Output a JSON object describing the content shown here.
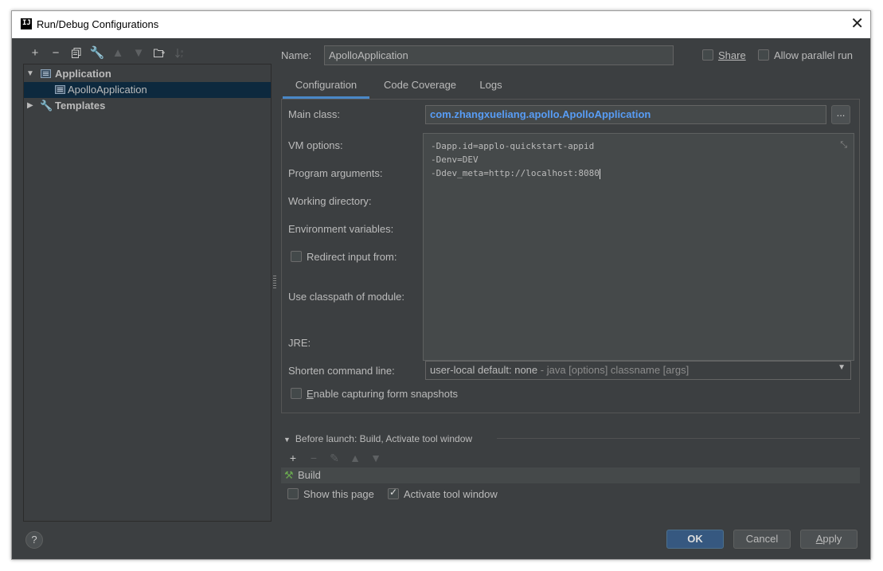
{
  "window": {
    "title": "Run/Debug Configurations",
    "logo_text": "IJ"
  },
  "tree": {
    "items": [
      {
        "label": "Application",
        "expanded": true
      },
      {
        "label": "ApolloApplication",
        "selected": true
      },
      {
        "label": "Templates",
        "expanded": false
      }
    ]
  },
  "left_toolbar": {
    "icons": [
      "add-icon",
      "remove-icon",
      "copy-icon",
      "wrench-icon",
      "move-up-icon",
      "move-down-icon",
      "new-folder-icon",
      "sort-icon"
    ]
  },
  "header": {
    "name_label": "Name:",
    "name_value": "ApolloApplication",
    "share_label": "Share",
    "allow_parallel_label": "Allow parallel run"
  },
  "tabs": [
    {
      "label": "Configuration",
      "active": true
    },
    {
      "label": "Code Coverage",
      "active": false
    },
    {
      "label": "Logs",
      "active": false
    }
  ],
  "form": {
    "main_class_label": "Main class:",
    "main_class_value": "com.zhangxueliang.apollo.ApolloApplication",
    "browse_label": "...",
    "vm_options_label": "VM options:",
    "vm_options_lines": [
      "-Dapp.id=applo-quickstart-appid",
      "-Denv=DEV",
      "-Ddev_meta=http://localhost:8080"
    ],
    "program_args_label": "Program arguments:",
    "working_dir_label": "Working directory:",
    "env_vars_label": "Environment variables:",
    "redirect_label": "Redirect input from:",
    "classpath_label": "Use classpath of module:",
    "jre_label": "JRE:",
    "shorten_label": "Shorten command line:",
    "shorten_value": "user-local default: none",
    "shorten_hint": " - java [options] classname [args]",
    "snapshots_label": "Enable capturing form snapshots"
  },
  "before_launch": {
    "header": "Before launch: Build, Activate tool window",
    "task": "Build",
    "show_page_label": "Show this page",
    "activate_label": "Activate tool window",
    "activate_checked": true
  },
  "footer": {
    "help": "?",
    "ok": "OK",
    "cancel": "Cancel",
    "apply": "Apply"
  },
  "colors": {
    "background": "#3c3f41",
    "selection": "#0d293e",
    "link_blue": "#589df6",
    "primary_button": "#365880",
    "tab_underline": "#4a88c7"
  }
}
